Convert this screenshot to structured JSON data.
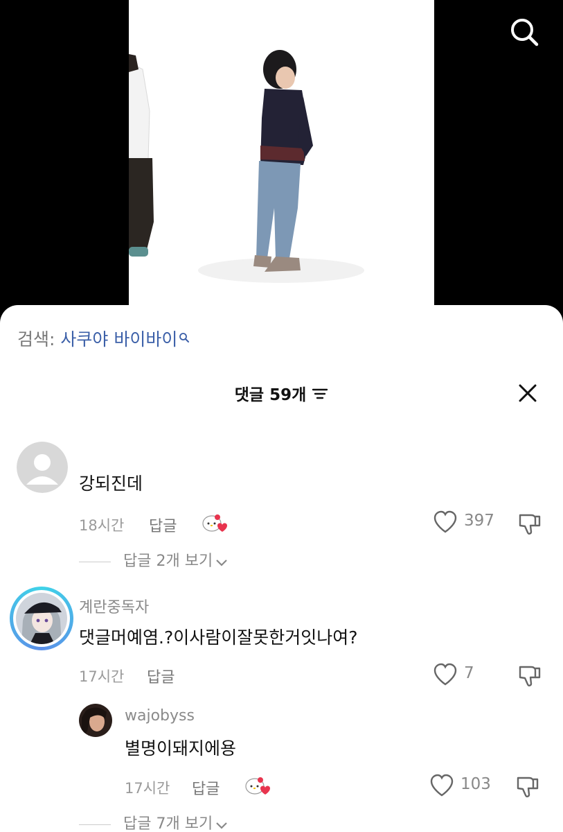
{
  "video": {
    "search_icon": "search-icon"
  },
  "search_suggestion": {
    "prefix": "검색: ",
    "keyword": "사쿠야 바이바이"
  },
  "comments_header": {
    "title": "댓글 59개",
    "filter_icon": "filter-icon",
    "close_icon": "close-icon"
  },
  "comments": [
    {
      "username": "",
      "text": "강되진데",
      "time": "18시간",
      "reply_label": "답글",
      "has_sticker": true,
      "likes": "397",
      "view_replies": "답글 2개 보기"
    },
    {
      "username": "계란중독자",
      "text": "댓글머예염.?이사람이잘못한거잇나여?",
      "time": "17시간",
      "reply_label": "답글",
      "has_sticker": false,
      "likes": "7",
      "replies": [
        {
          "username": "wajobyss",
          "text": "별명이돼지에용",
          "time": "17시간",
          "reply_label": "답글",
          "has_sticker": true,
          "likes": "103"
        }
      ],
      "view_replies": "답글 7개 보기"
    }
  ],
  "colors": {
    "accent_blue": "#3b5fa8",
    "heart_red": "#e8344e"
  }
}
